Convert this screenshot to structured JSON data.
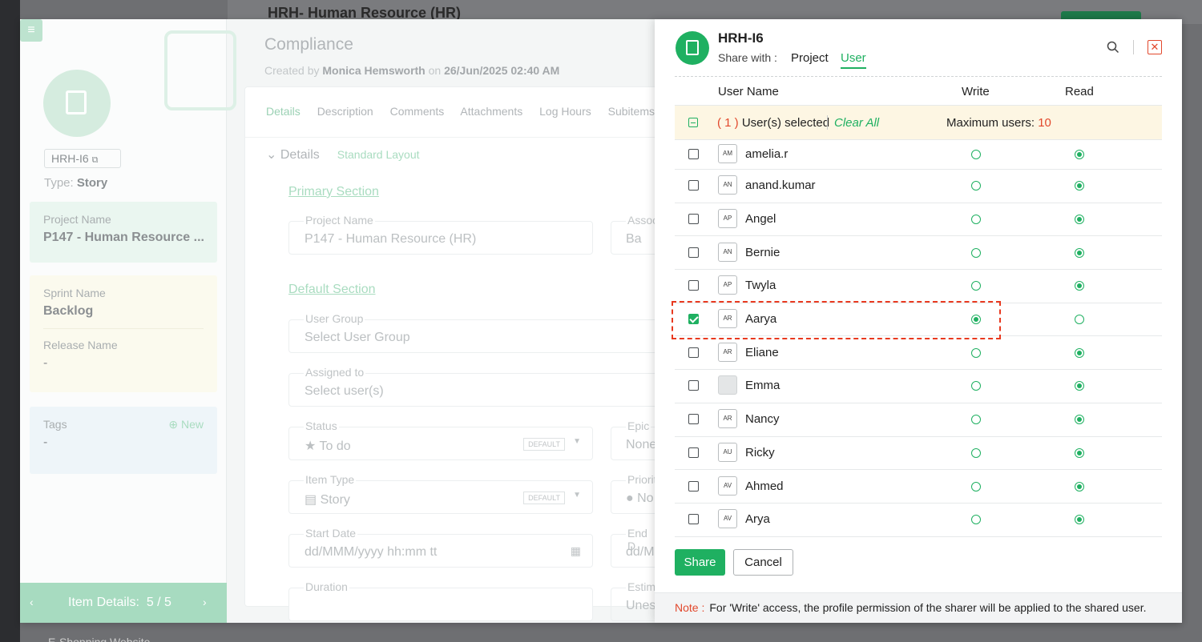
{
  "background": {
    "header_title_prefix": "HRH-",
    "header_title": "Human Resource (HR)",
    "footer_text": "E-Shopping Website"
  },
  "detail": {
    "item_id": "HRH-I6",
    "type_label": "Type:",
    "type_value": "Story",
    "project_label": "Project Name",
    "project_value": "P147 - Human Resource ...",
    "sprint_label": "Sprint Name",
    "sprint_value": "Backlog",
    "release_label": "Release Name",
    "release_value": "-",
    "tags_label": "Tags",
    "tags_new": "New",
    "tags_value": "-",
    "footer_label": "Item Details:",
    "footer_count": "5 / 5",
    "title": "Compliance",
    "created_by_prefix": "Created by",
    "created_by_name": "Monica Hemsworth",
    "created_on_prefix": "on",
    "created_on": "26/Jun/2025 02:40 AM",
    "tabs": [
      "Details",
      "Description",
      "Comments",
      "Attachments",
      "Log Hours",
      "Subitems"
    ],
    "details_heading": "Details",
    "layout_label": "Standard Layout",
    "primary_section": "Primary Section",
    "default_section": "Default Section",
    "fields": {
      "project_name_label": "Project Name",
      "project_name_value": "P147 - Human Resource (HR)",
      "assoc_label": "Assoc",
      "assoc_value": "Ba",
      "user_group_label": "User Group",
      "user_group_placeholder": "Select User Group",
      "assigned_label": "Assigned to",
      "assigned_placeholder": "Select user(s)",
      "status_label": "Status",
      "status_value": "To do",
      "default_badge": "DEFAULT",
      "epic_label": "Epic",
      "epic_value": "None",
      "item_type_label": "Item Type",
      "item_type_value": "Story",
      "priority_label": "Priorit",
      "priority_value": "No",
      "start_label": "Start Date",
      "start_placeholder": "dd/MMM/yyyy hh:mm tt",
      "end_label": "End D",
      "end_placeholder": "dd/M",
      "duration_label": "Duration",
      "estimate_label": "Estima",
      "estimate_value": "Unes"
    }
  },
  "share": {
    "title": "HRH-I6",
    "share_with_label": "Share with :",
    "tabs": {
      "project": "Project",
      "user": "User"
    },
    "columns": {
      "user_name": "User Name",
      "write": "Write",
      "read": "Read"
    },
    "selected_count_open": "( 1 )",
    "selected_text": "User(s) selected",
    "clear_all": "Clear All",
    "max_users_label": "Maximum users:",
    "max_users_value": "10",
    "users": [
      {
        "initials": "AM",
        "name": "amelia.r",
        "checked": false,
        "write": false,
        "read": true
      },
      {
        "initials": "AN",
        "name": "anand.kumar",
        "checked": false,
        "write": false,
        "read": true
      },
      {
        "initials": "AP",
        "name": "Angel",
        "checked": false,
        "write": false,
        "read": true
      },
      {
        "initials": "AN",
        "name": "Bernie",
        "checked": false,
        "write": false,
        "read": true
      },
      {
        "initials": "AP",
        "name": "Twyla",
        "checked": false,
        "write": false,
        "read": true
      },
      {
        "initials": "AR",
        "name": "Aarya",
        "checked": true,
        "write": true,
        "read": false
      },
      {
        "initials": "AR",
        "name": "Eliane",
        "checked": false,
        "write": false,
        "read": true
      },
      {
        "initials": "",
        "name": "Emma",
        "checked": false,
        "write": false,
        "read": true
      },
      {
        "initials": "AR",
        "name": "Nancy",
        "checked": false,
        "write": false,
        "read": true
      },
      {
        "initials": "AU",
        "name": "Ricky",
        "checked": false,
        "write": false,
        "read": true
      },
      {
        "initials": "AV",
        "name": "Ahmed",
        "checked": false,
        "write": false,
        "read": true
      },
      {
        "initials": "AV",
        "name": "Arya",
        "checked": false,
        "write": false,
        "read": true
      }
    ],
    "share_button": "Share",
    "cancel_button": "Cancel",
    "note_label": "Note :",
    "note_text": "For 'Write' access, the profile permission of the sharer will be applied to the shared user."
  }
}
